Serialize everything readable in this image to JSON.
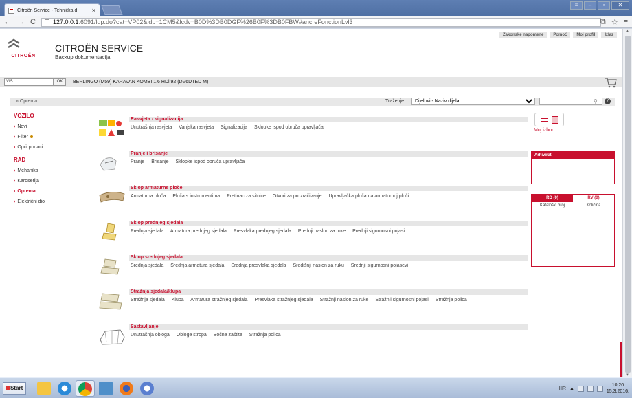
{
  "browser": {
    "tab_title": "Citroën Service - Tehnička d",
    "url_host": "127.0.0.1",
    "url_path": ":6091/ldp.do?cat=VP02&ldp=1CM5&lcdv=B0D%3DB0DGF%26B0F%3DB0FBW#ancreFonctionLvl3"
  },
  "header": {
    "top_links": [
      "Zakonske napomene",
      "Pomoć",
      "Moj profil",
      "Izlaz"
    ],
    "logo_word": "CITROËN",
    "brand_title": "CITROËN SERVICE",
    "brand_subtitle": "Backup dokumentacija"
  },
  "vin_bar": {
    "vin_value": "VIS",
    "ok_label": "OK",
    "vehicle": "BERLINGO (M59) KARAVAN KOMBI 1.6 HDi 92 (DV6DTED M)"
  },
  "search_bar": {
    "oprema_link": "» Oprema",
    "search_label": "Traženje",
    "search_select_value": "Dijelovi - Naziv dijela",
    "search_query": ""
  },
  "sidebar": {
    "vozilo_title": "VOZILO",
    "vozilo_items": [
      "Novi",
      "Filter",
      "Opći podaci"
    ],
    "rad_title": "RAD",
    "rad_items": [
      "Mehanika",
      "Karoserija",
      "Oprema",
      "Električni dio"
    ]
  },
  "categories": [
    {
      "title": "Rasvjeta - signalizacija",
      "items": [
        "Unutrašnja rasvjeta",
        "Vanjska rasvjeta",
        "Signalizacija",
        "Sklopke ispod obruča upravljača"
      ]
    },
    {
      "title": "Pranje i brisanje",
      "items": [
        "Pranje",
        "Brisanje",
        "Sklopke ispod obruča upravljača"
      ]
    },
    {
      "title": "Sklop armaturne ploče",
      "items": [
        "Armaturna ploča",
        "Ploča s instrumentima",
        "Pretinac za sitnice",
        "Otvori za prozračivanje",
        "Upravljačka ploča na armaturnoj ploči"
      ]
    },
    {
      "title": "Sklop prednjeg sjedala",
      "items": [
        "Prednja sjedala",
        "Armatura prednjeg sjedala",
        "Presvlaka prednjeg sjedala",
        "Prednji naslon za ruke",
        "Prednji sigurnosni pojasi"
      ]
    },
    {
      "title": "Sklop srednjeg sjedala",
      "items": [
        "Srednja sjedala",
        "Srednja armatura sjedala",
        "Srednja presvlaka sjedala",
        "Središnji naslon za ruku",
        "Srednji sigurnosni pojasevi"
      ]
    },
    {
      "title": "Stražnja sjedala/klupa",
      "items": [
        "Stražnja sjedala",
        "Klupa",
        "Armatura stražnjeg sjedala",
        "Presvlaka stražnjeg sjedala",
        "Stražnji naslon za ruke",
        "Stražnji sigurnosni pojasi",
        "Stražnja polica"
      ]
    },
    {
      "title": "Sastavljanje",
      "items": [
        "Unutrašnja obloga",
        "Obloge stropa",
        "Bočne zaštite",
        "Stražnja polica"
      ]
    }
  ],
  "right_panel": {
    "moj_izbor": "Moj izbor",
    "arhivirati": "Arhivirati",
    "tab_rd": "RD (0)",
    "tab_rv": "RV (0)",
    "col_catalog": "Kataloški broj",
    "col_qty": "Količina"
  },
  "taskbar": {
    "start_label": "Start",
    "lang": "HR",
    "time": "10:20",
    "date": "15.3.2016."
  },
  "colors": {
    "brand_red": "#c8102e",
    "taskbar": "#b6c7df"
  }
}
